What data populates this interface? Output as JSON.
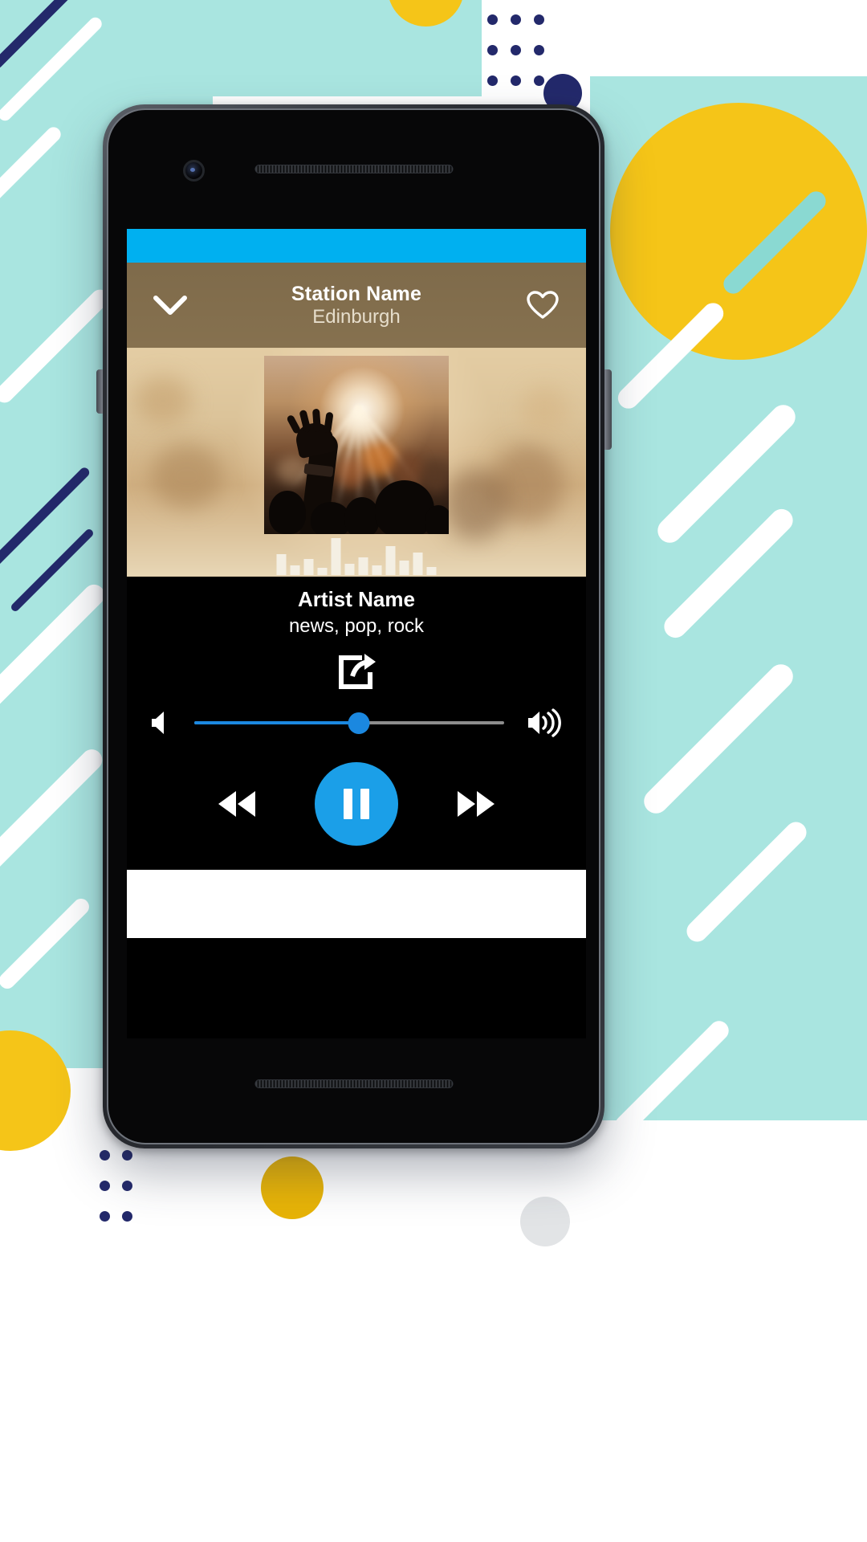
{
  "app": {
    "screen_name": "radio-player",
    "status_bar_color": "#00b0f0",
    "app_bar_color": "#86714f",
    "accent_color": "#1b9fe8",
    "slider_fill_color": "#1b88e0",
    "background_color": "#000000"
  },
  "app_bar": {
    "collapse_icon": "chevron-down-icon",
    "station_name": "Station Name",
    "station_city": "Edinburgh",
    "favorite_icon": "heart-outline-icon"
  },
  "artwork": {
    "description_icon": "album-art",
    "equalizer_icon": "equalizer-bars",
    "equalizer_levels": [
      26,
      12,
      20,
      9,
      46,
      14,
      22,
      12,
      36,
      18,
      28,
      10
    ]
  },
  "track": {
    "artist_name": "Artist Name",
    "genres": "news, pop, rock"
  },
  "actions": {
    "share_icon": "share-icon",
    "share_label": "Share"
  },
  "volume": {
    "mute_icon": "volume-mute-icon",
    "max_icon": "volume-up-icon",
    "value_percent": 53
  },
  "transport": {
    "previous_icon": "rewind-icon",
    "previous_label": "Previous",
    "play_pause_icon": "pause-icon",
    "play_pause_label": "Pause",
    "next_icon": "fast-forward-icon",
    "next_label": "Next"
  },
  "ad": {
    "banner_label": ""
  },
  "device": {
    "front_camera": "front-camera-icon",
    "earpiece": "speaker-grille",
    "bottom_speaker": "speaker-grille",
    "power_button": "power-button",
    "volume_button": "volume-rocker"
  },
  "decor": {
    "teal": "#a9e5e0",
    "teal_dark": "#8ad9d2",
    "yellow": "#f5c518",
    "yellow_deep": "#e8b407",
    "navy": "#23296b",
    "white": "#ffffff",
    "light_grey": "#eef0f1"
  }
}
